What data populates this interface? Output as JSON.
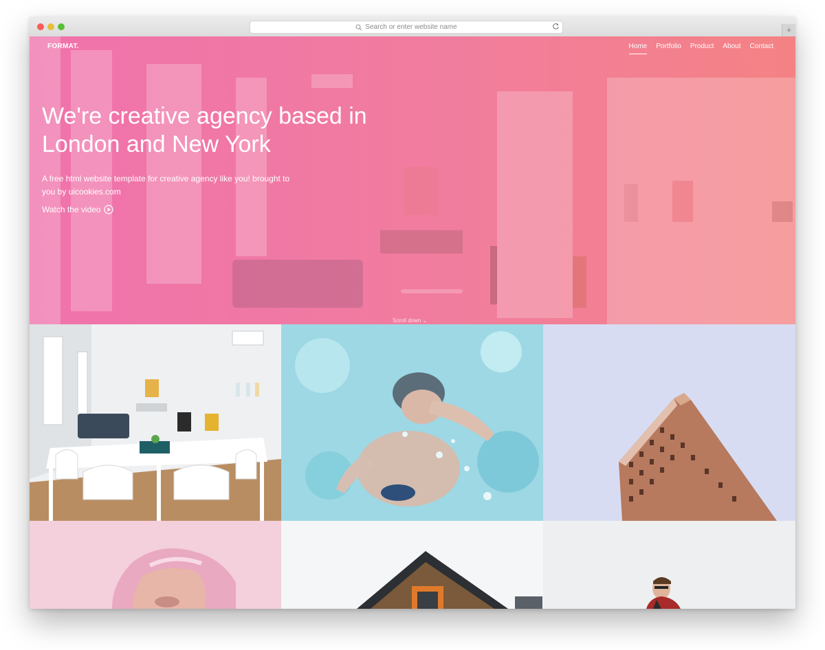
{
  "browser": {
    "search_placeholder": "Search or enter website name",
    "new_tab_label": "+"
  },
  "nav": {
    "logo": "FORMAT.",
    "items": [
      {
        "label": "Home",
        "active": true
      },
      {
        "label": "Portfolio",
        "active": false
      },
      {
        "label": "Product",
        "active": false
      },
      {
        "label": "About",
        "active": false
      },
      {
        "label": "Contact",
        "active": false
      }
    ]
  },
  "hero": {
    "title": "We're creative agency based in London and New York",
    "subtitle": "A free html website template for creative agency like you! brought to you by uicookies.com",
    "video_link": "Watch the video",
    "scroll_label": "Scroll down",
    "gradient": [
      "#f072ac",
      "#f48284"
    ]
  },
  "portfolio": {
    "tiles": [
      {
        "icon": "office-room-photo"
      },
      {
        "icon": "swimmer-underwater-photo"
      },
      {
        "icon": "flatiron-building-photo"
      },
      {
        "icon": "torn-pink-paper-face-photo"
      },
      {
        "icon": "wooden-cabin-roof-photo"
      },
      {
        "icon": "man-in-plaid-shirt-photo"
      }
    ]
  }
}
